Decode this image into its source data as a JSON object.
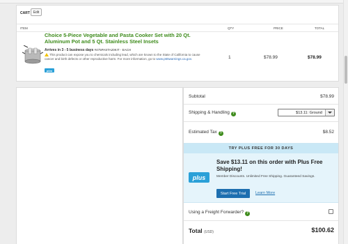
{
  "cart": {
    "title": "CART",
    "edit_label": "Edit",
    "columns": {
      "item": "ITEM",
      "qty": "QTY",
      "price": "PRICE",
      "total": "TOTAL"
    },
    "item": {
      "name": "Choice 5-Piece Vegetable and Pasta Cooker Set with 20 Qt. Aluminum Pot and 5 Qt. Stainless Steel Insets",
      "arrives": "Arrives in 3 - 5 business days",
      "sku": "#475PASTA20KIT - EACH",
      "warning": "This product can expose you to chemicals including lead, which are known to the State of California to cause cancer and birth defects or other reproductive harm. For more information, go to",
      "warning_link": "www.p65warnings.ca.gov.",
      "badge": "plus",
      "qty": "1",
      "price": "$78.99",
      "total": "$78.99",
      "image_icon": "pot-image"
    }
  },
  "summary": {
    "subtotal_label": "Subtotal",
    "subtotal_value": "$78.99",
    "shipping_label": "Shipping & Handling",
    "shipping_select": "$13.11: Ground",
    "tax_label": "Estimated Tax",
    "tax_value": "$8.52",
    "plus": {
      "banner": "TRY PLUS FREE FOR 30 DAYS",
      "logo": "plus",
      "headline": "Save $13.11 on this order with Plus Free Shipping!",
      "sub": "Member Discounts. Unlimited Free Shipping. Guaranteed Savings.",
      "trial_button": "Start Free Trial",
      "learn_more": "Learn More"
    },
    "freight_label": "Using a Freight Forwarder?",
    "total_label": "Total",
    "total_currency": "(USD)",
    "total_value": "$100.62"
  },
  "colors": {
    "accent_green": "#3f8c1d",
    "plus_blue": "#2aa0d8",
    "button_blue": "#1d6fb0"
  }
}
